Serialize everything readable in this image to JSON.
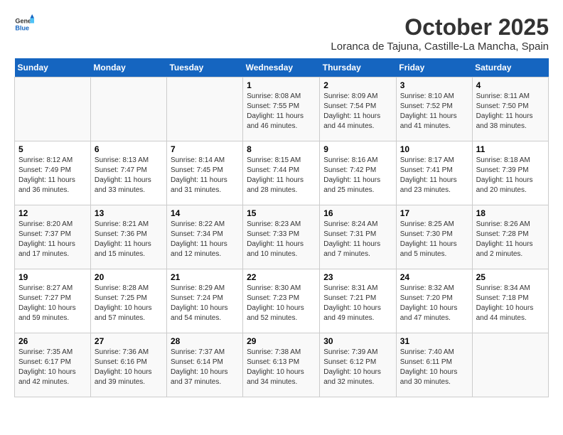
{
  "header": {
    "logo_general": "General",
    "logo_blue": "Blue",
    "title": "October 2025",
    "subtitle": "Loranca de Tajuna, Castille-La Mancha, Spain"
  },
  "calendar": {
    "days_of_week": [
      "Sunday",
      "Monday",
      "Tuesday",
      "Wednesday",
      "Thursday",
      "Friday",
      "Saturday"
    ],
    "weeks": [
      [
        {
          "day": "",
          "info": ""
        },
        {
          "day": "",
          "info": ""
        },
        {
          "day": "",
          "info": ""
        },
        {
          "day": "1",
          "info": "Sunrise: 8:08 AM\nSunset: 7:55 PM\nDaylight: 11 hours and 46 minutes."
        },
        {
          "day": "2",
          "info": "Sunrise: 8:09 AM\nSunset: 7:54 PM\nDaylight: 11 hours and 44 minutes."
        },
        {
          "day": "3",
          "info": "Sunrise: 8:10 AM\nSunset: 7:52 PM\nDaylight: 11 hours and 41 minutes."
        },
        {
          "day": "4",
          "info": "Sunrise: 8:11 AM\nSunset: 7:50 PM\nDaylight: 11 hours and 38 minutes."
        }
      ],
      [
        {
          "day": "5",
          "info": "Sunrise: 8:12 AM\nSunset: 7:49 PM\nDaylight: 11 hours and 36 minutes."
        },
        {
          "day": "6",
          "info": "Sunrise: 8:13 AM\nSunset: 7:47 PM\nDaylight: 11 hours and 33 minutes."
        },
        {
          "day": "7",
          "info": "Sunrise: 8:14 AM\nSunset: 7:45 PM\nDaylight: 11 hours and 31 minutes."
        },
        {
          "day": "8",
          "info": "Sunrise: 8:15 AM\nSunset: 7:44 PM\nDaylight: 11 hours and 28 minutes."
        },
        {
          "day": "9",
          "info": "Sunrise: 8:16 AM\nSunset: 7:42 PM\nDaylight: 11 hours and 25 minutes."
        },
        {
          "day": "10",
          "info": "Sunrise: 8:17 AM\nSunset: 7:41 PM\nDaylight: 11 hours and 23 minutes."
        },
        {
          "day": "11",
          "info": "Sunrise: 8:18 AM\nSunset: 7:39 PM\nDaylight: 11 hours and 20 minutes."
        }
      ],
      [
        {
          "day": "12",
          "info": "Sunrise: 8:20 AM\nSunset: 7:37 PM\nDaylight: 11 hours and 17 minutes."
        },
        {
          "day": "13",
          "info": "Sunrise: 8:21 AM\nSunset: 7:36 PM\nDaylight: 11 hours and 15 minutes."
        },
        {
          "day": "14",
          "info": "Sunrise: 8:22 AM\nSunset: 7:34 PM\nDaylight: 11 hours and 12 minutes."
        },
        {
          "day": "15",
          "info": "Sunrise: 8:23 AM\nSunset: 7:33 PM\nDaylight: 11 hours and 10 minutes."
        },
        {
          "day": "16",
          "info": "Sunrise: 8:24 AM\nSunset: 7:31 PM\nDaylight: 11 hours and 7 minutes."
        },
        {
          "day": "17",
          "info": "Sunrise: 8:25 AM\nSunset: 7:30 PM\nDaylight: 11 hours and 5 minutes."
        },
        {
          "day": "18",
          "info": "Sunrise: 8:26 AM\nSunset: 7:28 PM\nDaylight: 11 hours and 2 minutes."
        }
      ],
      [
        {
          "day": "19",
          "info": "Sunrise: 8:27 AM\nSunset: 7:27 PM\nDaylight: 10 hours and 59 minutes."
        },
        {
          "day": "20",
          "info": "Sunrise: 8:28 AM\nSunset: 7:25 PM\nDaylight: 10 hours and 57 minutes."
        },
        {
          "day": "21",
          "info": "Sunrise: 8:29 AM\nSunset: 7:24 PM\nDaylight: 10 hours and 54 minutes."
        },
        {
          "day": "22",
          "info": "Sunrise: 8:30 AM\nSunset: 7:23 PM\nDaylight: 10 hours and 52 minutes."
        },
        {
          "day": "23",
          "info": "Sunrise: 8:31 AM\nSunset: 7:21 PM\nDaylight: 10 hours and 49 minutes."
        },
        {
          "day": "24",
          "info": "Sunrise: 8:32 AM\nSunset: 7:20 PM\nDaylight: 10 hours and 47 minutes."
        },
        {
          "day": "25",
          "info": "Sunrise: 8:34 AM\nSunset: 7:18 PM\nDaylight: 10 hours and 44 minutes."
        }
      ],
      [
        {
          "day": "26",
          "info": "Sunrise: 7:35 AM\nSunset: 6:17 PM\nDaylight: 10 hours and 42 minutes."
        },
        {
          "day": "27",
          "info": "Sunrise: 7:36 AM\nSunset: 6:16 PM\nDaylight: 10 hours and 39 minutes."
        },
        {
          "day": "28",
          "info": "Sunrise: 7:37 AM\nSunset: 6:14 PM\nDaylight: 10 hours and 37 minutes."
        },
        {
          "day": "29",
          "info": "Sunrise: 7:38 AM\nSunset: 6:13 PM\nDaylight: 10 hours and 34 minutes."
        },
        {
          "day": "30",
          "info": "Sunrise: 7:39 AM\nSunset: 6:12 PM\nDaylight: 10 hours and 32 minutes."
        },
        {
          "day": "31",
          "info": "Sunrise: 7:40 AM\nSunset: 6:11 PM\nDaylight: 10 hours and 30 minutes."
        },
        {
          "day": "",
          "info": ""
        }
      ]
    ]
  }
}
